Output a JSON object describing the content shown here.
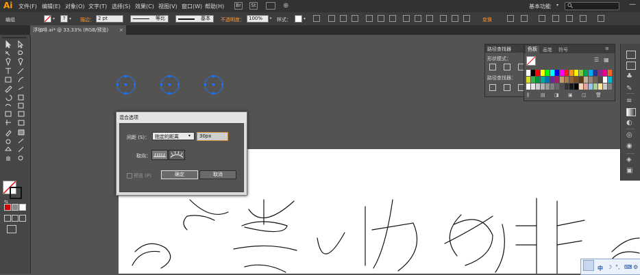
{
  "app": {
    "logo": "Ai"
  },
  "menubar": {
    "items": [
      "文件(F)",
      "编辑(E)",
      "对象(O)",
      "文字(T)",
      "选择(S)",
      "效果(C)",
      "视图(V)",
      "窗口(W)",
      "帮助(H)"
    ],
    "bridge_icon": "Br",
    "stock_icon": "St",
    "workspace": "基本功能",
    "search_placeholder": "",
    "minimize": "—"
  },
  "control_bar": {
    "selection": "编组",
    "stroke_label": "描边：",
    "stroke_value": "2 pt",
    "stroke_style": "等比",
    "brush_style": "基本",
    "opacity_label": "不透明度：",
    "opacity_value": "100%",
    "style_label": "样式：",
    "transform_label": "变换"
  },
  "document": {
    "tab_label": "浮咖啡.ai* @ 33.33% (RGB/预览)"
  },
  "blend_dialog": {
    "title": "混合选项",
    "spacing_label": "间距 (S)：",
    "spacing_option": "指定的距离",
    "spacing_value": "30px",
    "orientation_label": "取向：",
    "preview_label": "预览 (P)",
    "ok_label": "确定",
    "cancel_label": "取消"
  },
  "pathfinder_panel": {
    "tab": "路径查找器",
    "shape_modes_label": "形状模式：",
    "pathfinders_label": "路径查找器："
  },
  "swatches_panel": {
    "tabs": [
      "色板",
      "画笔",
      "符号"
    ],
    "colors_row1": [
      "#ffffff",
      "#000000",
      "#ff0000",
      "#ffff00",
      "#00ff00",
      "#00ffff",
      "#0000ff",
      "#ff00ff",
      "#ed1c24",
      "#f7941d",
      "#fff200",
      "#8dc63f",
      "#00a651",
      "#00aeef",
      "#2e3192",
      "#92278f",
      "#ec008c",
      "#f26522"
    ],
    "colors_row2": [
      "#d7df23",
      "#39b54a",
      "#009444",
      "#00a99d",
      "#0072bc",
      "#662d91",
      "#9e1f63",
      "#c69c6d",
      "#a67c52",
      "#8c6239",
      "#754c24",
      "#603913",
      "#c7b299",
      "#998675",
      "#736357",
      "#534741",
      "#ffffff",
      "#00b4d8"
    ],
    "colors_row3": [
      "#ffffff",
      "#e6e6e6",
      "#cccccc",
      "#b3b3b3",
      "#999999",
      "#808080",
      "#666666",
      "#4d4d4d",
      "#333333",
      "#1a1a1a",
      "#000000",
      "#f6d5b5",
      "#e4a4a4",
      "#9cc3e6",
      "#a9d08e",
      "#ffe699",
      "#c9c9c9",
      "#7f7f7f"
    ]
  },
  "ime_bar": {
    "label": "中"
  }
}
